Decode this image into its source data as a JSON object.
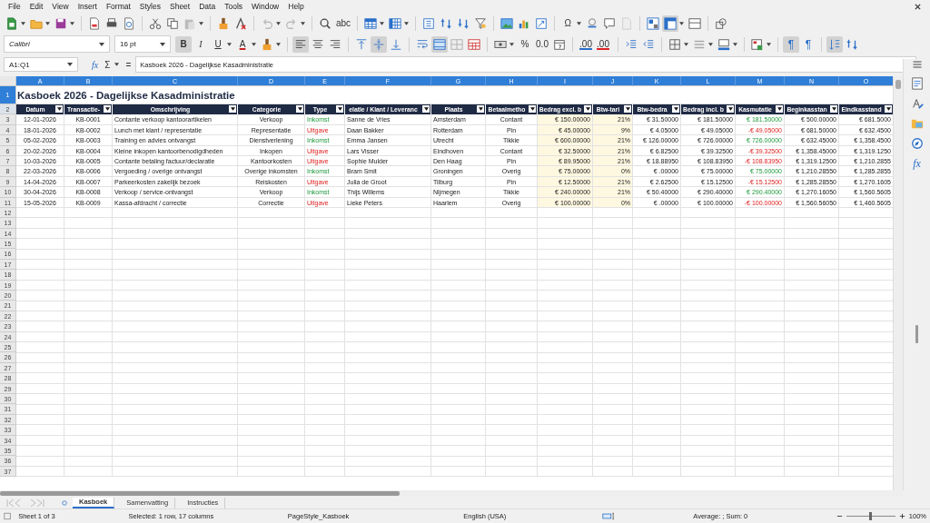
{
  "menu": [
    "File",
    "Edit",
    "View",
    "Insert",
    "Format",
    "Styles",
    "Sheet",
    "Data",
    "Tools",
    "Window",
    "Help"
  ],
  "glyphs": {
    "spelling": "abc",
    "special_char": "Ω",
    "bold": "B",
    "italic": "I",
    "underline": "U",
    "font_color": "A",
    "percent": "%",
    "number": "0.0",
    "add_decimal": ".00",
    "delete_decimal": ".00",
    "ltr": "¶",
    "rtl": "¶",
    "function_wizard": "fx",
    "sum": "Σ",
    "equals": "=",
    "sidebar_functions": "fx"
  },
  "toggles": {
    "freeze": true,
    "bold": true,
    "align_left": true,
    "align_middle": true,
    "merge_center": true,
    "ltr": true,
    "stacked": true
  },
  "font": {
    "name": "Calibri",
    "size": "16 pt"
  },
  "name_box": "A1:Q1",
  "formula": "Kasboek 2026 - Dagelijkse Kasadministratie",
  "columns": [
    {
      "letter": "A",
      "selected": true,
      "shaded": false
    },
    {
      "letter": "B",
      "selected": true,
      "shaded": false
    },
    {
      "letter": "C",
      "selected": true,
      "shaded": false
    },
    {
      "letter": "D",
      "selected": true,
      "shaded": false
    },
    {
      "letter": "E",
      "selected": true,
      "shaded": false
    },
    {
      "letter": "F",
      "selected": true,
      "shaded": false
    },
    {
      "letter": "G",
      "selected": true,
      "shaded": false
    },
    {
      "letter": "H",
      "selected": true,
      "shaded": false
    },
    {
      "letter": "I",
      "selected": true,
      "shaded": true
    },
    {
      "letter": "J",
      "selected": true,
      "shaded": true
    },
    {
      "letter": "K",
      "selected": true,
      "shaded": false
    },
    {
      "letter": "L",
      "selected": true,
      "shaded": false
    },
    {
      "letter": "M",
      "selected": true,
      "shaded": false
    },
    {
      "letter": "N",
      "selected": true,
      "shaded": false
    },
    {
      "letter": "O",
      "selected": true,
      "shaded": false
    }
  ],
  "title_row": {
    "number": "1",
    "selected": true,
    "text": "Kasboek 2026 - Dagelijkse Kasadministratie"
  },
  "header_row": {
    "number": "2",
    "cells": [
      "Datum",
      "Transactie-",
      "Omschrijving",
      "Categorie",
      "Type",
      "elatie / Klant / Leveranc",
      "Plaats",
      "Betaalmetho",
      "Bedrag excl. b",
      "Btw-tari",
      "Btw-bedra",
      "Bedrag incl. b",
      "Kasmutatie",
      "Beginkasstan",
      "Eindkasstand"
    ]
  },
  "rows": [
    {
      "number": "3",
      "income": true,
      "cells": [
        "12-01-2026",
        "KB-0001",
        "Contante verkoop kantoorartikelen",
        "Verkoop",
        "Inkomst",
        "Sanne de Vries",
        "Amsterdam",
        "Contant",
        "€ 150.00000",
        "21%",
        "€ 31.50000",
        "€ 181.50000",
        "€ 181.50000",
        "€ 500.00000",
        "€ 681.5000"
      ]
    },
    {
      "number": "4",
      "income": false,
      "cells": [
        "18-01-2026",
        "KB-0002",
        "Lunch met klant / representatie",
        "Representatie",
        "Uitgave",
        "Daan Bakker",
        "Rotterdam",
        "Pin",
        "€ 45.00000",
        "9%",
        "€ 4.05000",
        "€ 49.05000",
        "-€ 49.05000",
        "€ 681.50000",
        "€ 632.4500"
      ]
    },
    {
      "number": "5",
      "income": true,
      "cells": [
        "05-02-2026",
        "KB-0003",
        "Training en advies ontvangst",
        "Dienstverlening",
        "Inkomst",
        "Emma Jansen",
        "Utrecht",
        "Tikkie",
        "€ 600.00000",
        "21%",
        "€ 126.00000",
        "€ 726.00000",
        "€ 726.00000",
        "€ 632.45000",
        "€ 1,358.4500"
      ]
    },
    {
      "number": "6",
      "income": false,
      "cells": [
        "20-02-2026",
        "KB-0004",
        "Kleine inkopen kantoorbenodigdheden",
        "Inkopen",
        "Uitgave",
        "Lars Visser",
        "Eindhoven",
        "Contant",
        "€ 32.50000",
        "21%",
        "€ 6.82500",
        "€ 39.32500",
        "-€ 39.32500",
        "€ 1,358.45000",
        "€ 1,319.1250"
      ]
    },
    {
      "number": "7",
      "income": false,
      "cells": [
        "10-03-2026",
        "KB-0005",
        "Contante betaling factuur/declaratie",
        "Kantoorkosten",
        "Uitgave",
        "Sophie Mulder",
        "Den Haag",
        "Pin",
        "€ 89.95000",
        "21%",
        "€ 18.88950",
        "€ 108.83950",
        "-€ 108.83950",
        "€ 1,319.12500",
        "€ 1,210.2855"
      ]
    },
    {
      "number": "8",
      "income": true,
      "cells": [
        "22-03-2026",
        "KB-0006",
        "Vergoeding / overige ontvangst",
        "Overige inkomsten",
        "Inkomst",
        "Bram Smit",
        "Groningen",
        "Overig",
        "€ 75.00000",
        "0%",
        "€ .00000",
        "€ 75.00000",
        "€ 75.00000",
        "€ 1,210.28550",
        "€ 1,285.2855"
      ]
    },
    {
      "number": "9",
      "income": false,
      "cells": [
        "14-04-2026",
        "KB-0007",
        "Parkeerkosten zakelijk bezoek",
        "Reiskosten",
        "Uitgave",
        "Julia de Groot",
        "Tilburg",
        "Pin",
        "€ 12.50000",
        "21%",
        "€ 2.62500",
        "€ 15.12500",
        "-€ 15.12500",
        "€ 1,285.28550",
        "€ 1,270.1605"
      ]
    },
    {
      "number": "10",
      "income": true,
      "cells": [
        "30-04-2026",
        "KB-0008",
        "Verkoop / service-ontvangst",
        "Verkoop",
        "Inkomst",
        "Thijs Willems",
        "Nijmegen",
        "Tikkie",
        "€ 240.00000",
        "21%",
        "€ 50.40000",
        "€ 290.40000",
        "€ 290.40000",
        "€ 1,270.16050",
        "€ 1,560.5605"
      ]
    },
    {
      "number": "11",
      "income": false,
      "cells": [
        "15-05-2026",
        "KB-0009",
        "Kassa-afdracht / correctie",
        "Correctie",
        "Uitgave",
        "Lieke Peters",
        "Haarlem",
        "Overig",
        "€ 100.00000",
        "0%",
        "€ .00000",
        "€ 100.00000",
        "-€ 100.00000",
        "€ 1,560.56050",
        "€ 1,460.5605"
      ]
    }
  ],
  "empty_rows": [
    "12",
    "13",
    "14",
    "15",
    "16",
    "17",
    "18",
    "19",
    "20",
    "21",
    "22",
    "23",
    "24",
    "25",
    "26",
    "27",
    "28",
    "29",
    "30",
    "31",
    "32",
    "33",
    "34",
    "35",
    "36",
    "37"
  ],
  "sheet_tabs": [
    {
      "label": "Kasboek",
      "selected": true
    },
    {
      "label": "Samenvatting",
      "selected": false
    },
    {
      "label": "Instructies",
      "selected": false
    }
  ],
  "status": {
    "sheet": "Sheet 1 of 3",
    "selection": "Selected: 1 row, 17 columns",
    "page_style": "PageStyle_Kasboek",
    "language": "English (USA)",
    "summary": "Average: ; Sum: 0"
  },
  "zoom": {
    "level": 0.5,
    "label": "100%"
  }
}
